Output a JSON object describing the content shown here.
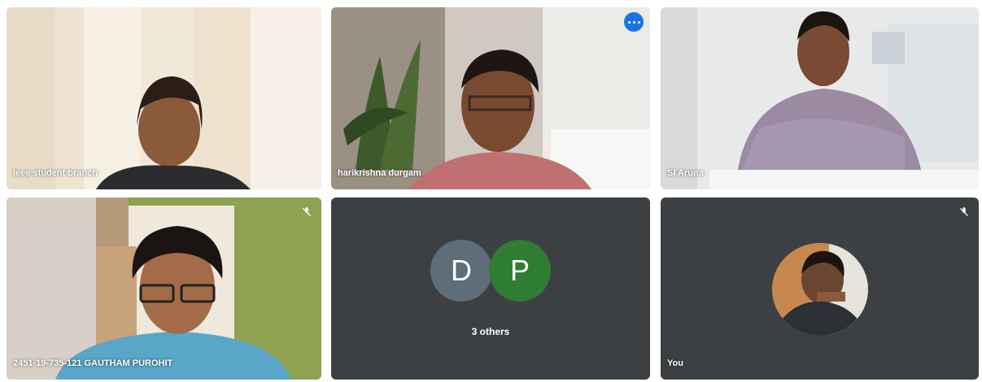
{
  "tiles": {
    "t1": {
      "name": "ieee student branch"
    },
    "t2": {
      "name": "harikrishna durgam"
    },
    "t3": {
      "name": "SI Aruna"
    },
    "t4": {
      "name": "2451-19-735-121 GAUTHAM PUROHIT"
    },
    "t5": {
      "avatars": [
        "D",
        "P"
      ],
      "label": "3 others"
    },
    "t6": {
      "name": "You"
    }
  },
  "colors": {
    "background": "#ffffff",
    "tile": "#3c4043",
    "active_border": "#8ab4f8",
    "avatar_d": "#5f6d78",
    "avatar_p": "#2e7d32"
  },
  "icons": {
    "more": "more-options-icon",
    "mic_off": "mic-off-icon"
  }
}
